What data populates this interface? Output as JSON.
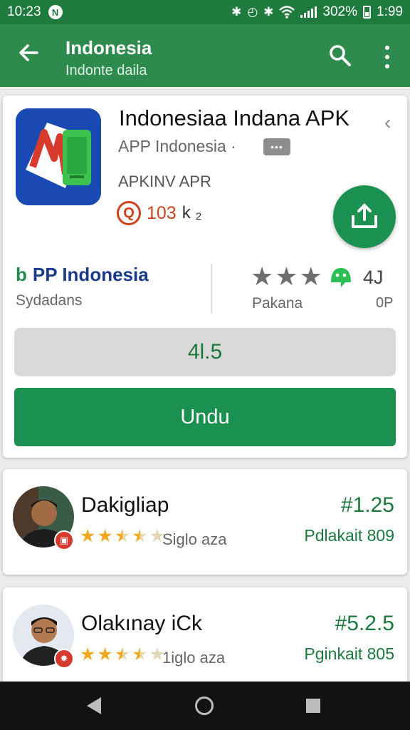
{
  "status_bar": {
    "time": "10:23",
    "nfc_glyph": "N",
    "battery_text": "302%",
    "clock_right": "1:99",
    "icons": [
      "bluetooth-icon",
      "alarm-icon",
      "wifi-icon",
      "signal-icon",
      "battery-icon"
    ]
  },
  "app_bar": {
    "title": "Indonesia",
    "subtitle": "Indonte daila",
    "icons": [
      "back-arrow-icon",
      "search-icon",
      "more-vert-icon"
    ]
  },
  "app": {
    "name": "Indonesiaa Indana APK",
    "developer": "APP Indonesia ·",
    "developer_badge": "•••",
    "tag": "APKINV APR",
    "stat_icon": "Q",
    "stat_value": "103",
    "stat_suffix": "k ₂",
    "publisher_logo": "b",
    "publisher": "PP Indonesia",
    "publisher_sub": "Sydadans",
    "stars_value": "4J",
    "stars_label": "Pakana",
    "stars_sub": "0P",
    "rating": "4l.5",
    "download_label": "Undu"
  },
  "reviews": [
    {
      "name": "Dakigliap",
      "rating": 2.5,
      "meta": "Siglo aza",
      "rank": "#1.25",
      "sub": "Pdlakait 809",
      "badge": "▣"
    },
    {
      "name": "Olakınay iCk",
      "rating": 2.5,
      "meta": "1iglo aza",
      "rank": "#5.2.5",
      "sub": "Pginkait 805",
      "badge": "✸"
    }
  ],
  "colors": {
    "status_bar": "#1f7a3d",
    "app_bar": "#2e8b4e",
    "accent_green": "#1a9150",
    "stat_red": "#d0421b",
    "star_gold": "#f2a81d"
  }
}
